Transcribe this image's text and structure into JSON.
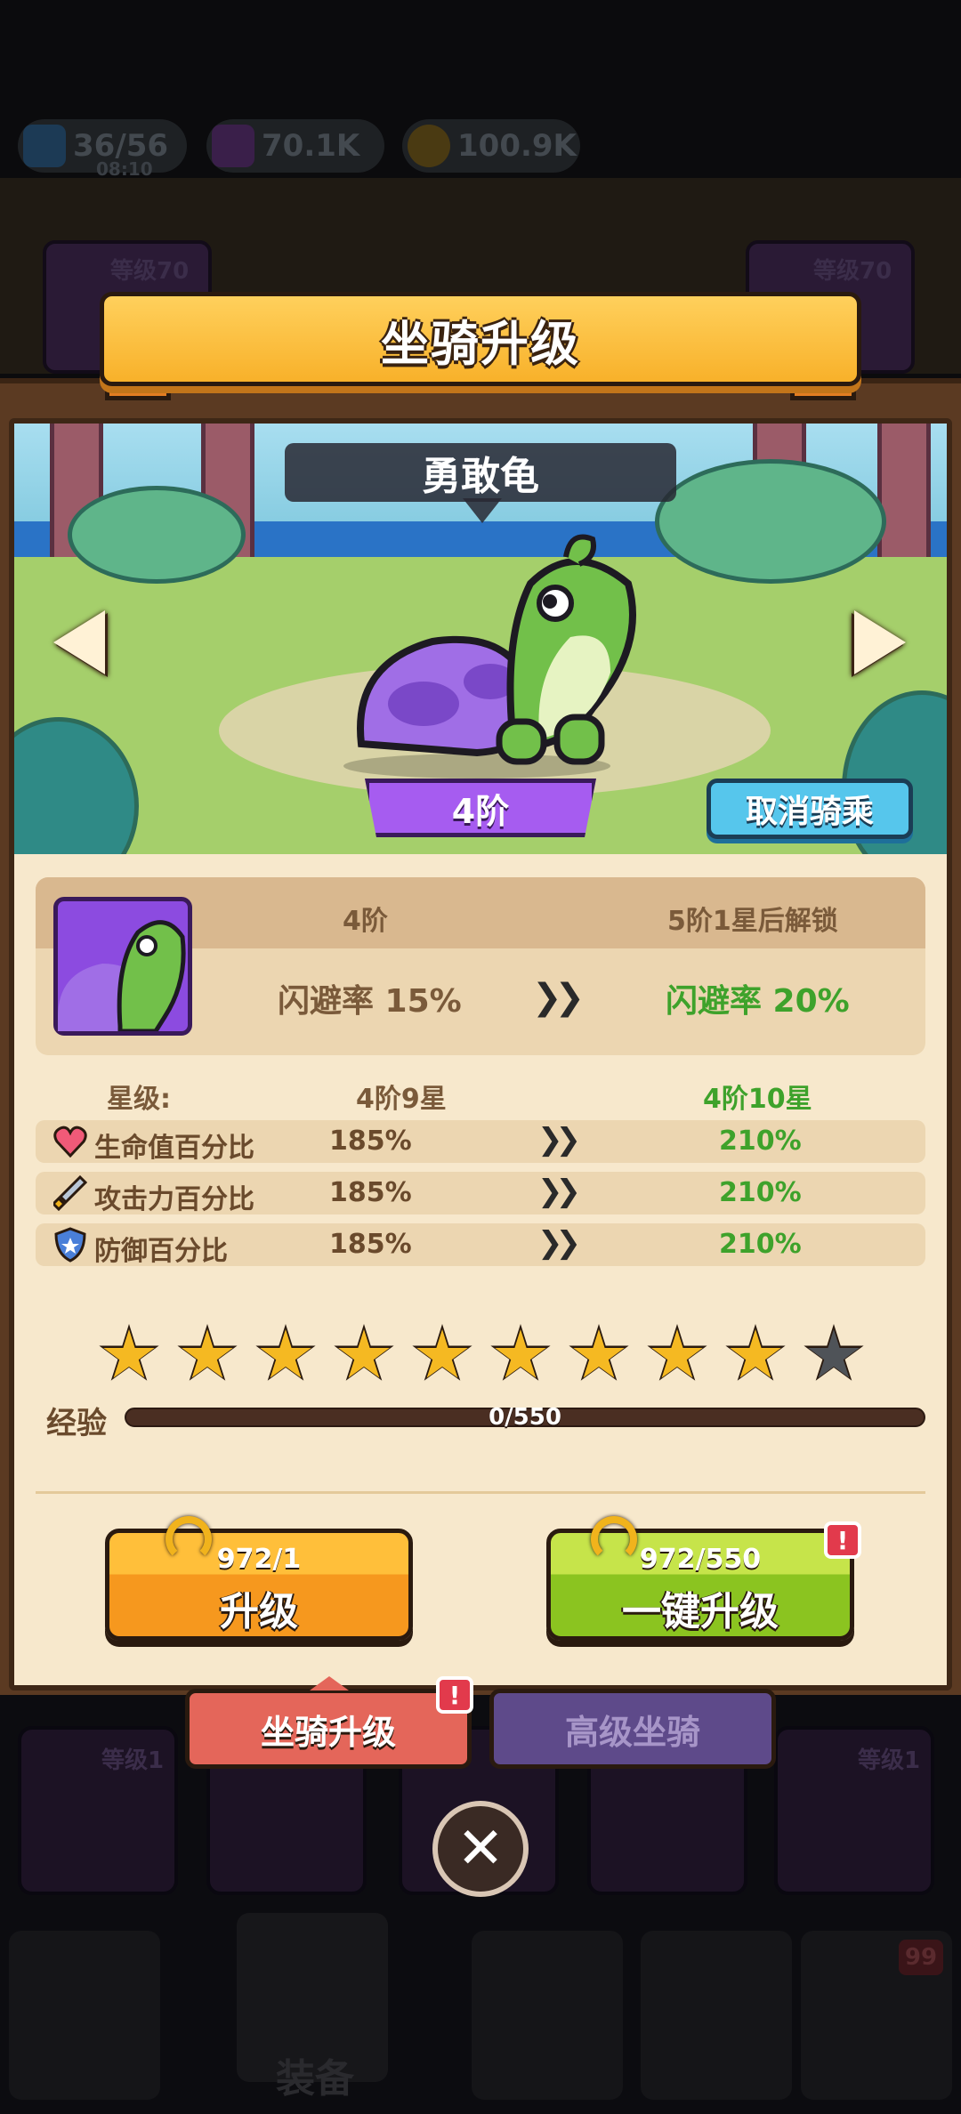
{
  "header": {
    "energy": "36/56",
    "energy_timer": "08:10",
    "gems": "70.1K",
    "gold": "100.9K"
  },
  "background": {
    "card_level_left": "等级70",
    "card_level_right": "等级70",
    "slot_level_left": "等级1",
    "slot_level_right": "等级1",
    "nav_label": "装备",
    "nav_badge": "99"
  },
  "modal": {
    "title": "坐骑升级",
    "mount_name": "勇敢龟",
    "tier": "4阶",
    "dismount_label": "取消骑乘"
  },
  "info": {
    "current_tier": "4阶",
    "next_unlock": "5阶1星后解锁",
    "current_effect": "闪避率 15%",
    "next_effect": "闪避率 20%"
  },
  "stats": {
    "star_label": "星级:",
    "star_current": "4阶9星",
    "star_next": "4阶10星",
    "rows": [
      {
        "icon": "heart-icon",
        "label": "生命值百分比",
        "current": "185%",
        "next": "210%"
      },
      {
        "icon": "sword-icon",
        "label": "攻击力百分比",
        "current": "185%",
        "next": "210%"
      },
      {
        "icon": "shield-icon",
        "label": "防御百分比",
        "current": "185%",
        "next": "210%"
      }
    ]
  },
  "stars": {
    "filled": 9,
    "total": 10
  },
  "exp": {
    "label": "经验",
    "value": "0/550",
    "progress": 0
  },
  "buttons": {
    "upgrade_cost": "972/1",
    "upgrade_label": "升级",
    "oneclick_cost": "972/550",
    "oneclick_label": "一键升级",
    "alert_mark": "!"
  },
  "tabs": {
    "upgrade": "坐骑升级",
    "advanced": "高级坐骑"
  },
  "close_symbol": "✕",
  "colors": {
    "accent_orange": "#f6981e",
    "accent_green": "#8bc420",
    "tier_purple": "#a65cf0",
    "stat_next_green": "#3ea22b"
  }
}
